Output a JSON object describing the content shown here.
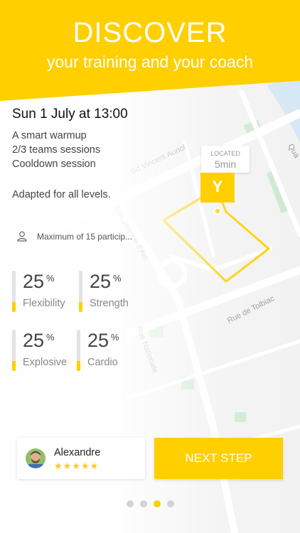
{
  "header": {
    "title": "DISCOVER",
    "subtitle": "your training and your coach"
  },
  "session": {
    "date": "Sun 1 July at 13:00",
    "program": [
      "A smart warmup",
      "2/3 teams sessions",
      "Cooldown session"
    ],
    "levels": "Adapted for all levels.",
    "participants": "Maximum of 15 particip..."
  },
  "stats": [
    {
      "value": "25",
      "unit": "%",
      "label": "Flexibility",
      "level": 0.25
    },
    {
      "value": "25",
      "unit": "%",
      "label": "Strength",
      "level": 0.25
    },
    {
      "value": "25",
      "unit": "%",
      "label": "Explosive",
      "level": 0.25
    },
    {
      "value": "25",
      "unit": "%",
      "label": "Cardio",
      "level": 0.25
    }
  ],
  "map": {
    "streets": [
      "Bd Vincent Auriol",
      "Rue Jeanne d'Arc",
      "Rue Nationale",
      "Rue de Tolbiac",
      "Qua"
    ],
    "location_label": "LOCATED",
    "location_time": "5min",
    "marker_letter": "Y"
  },
  "coach": {
    "name": "Alexandre",
    "rating_stars": "★★★★★"
  },
  "next_button": "NEXT STEP",
  "pagination": {
    "count": 4,
    "active": 3
  },
  "colors": {
    "accent": "#ffcf00"
  }
}
